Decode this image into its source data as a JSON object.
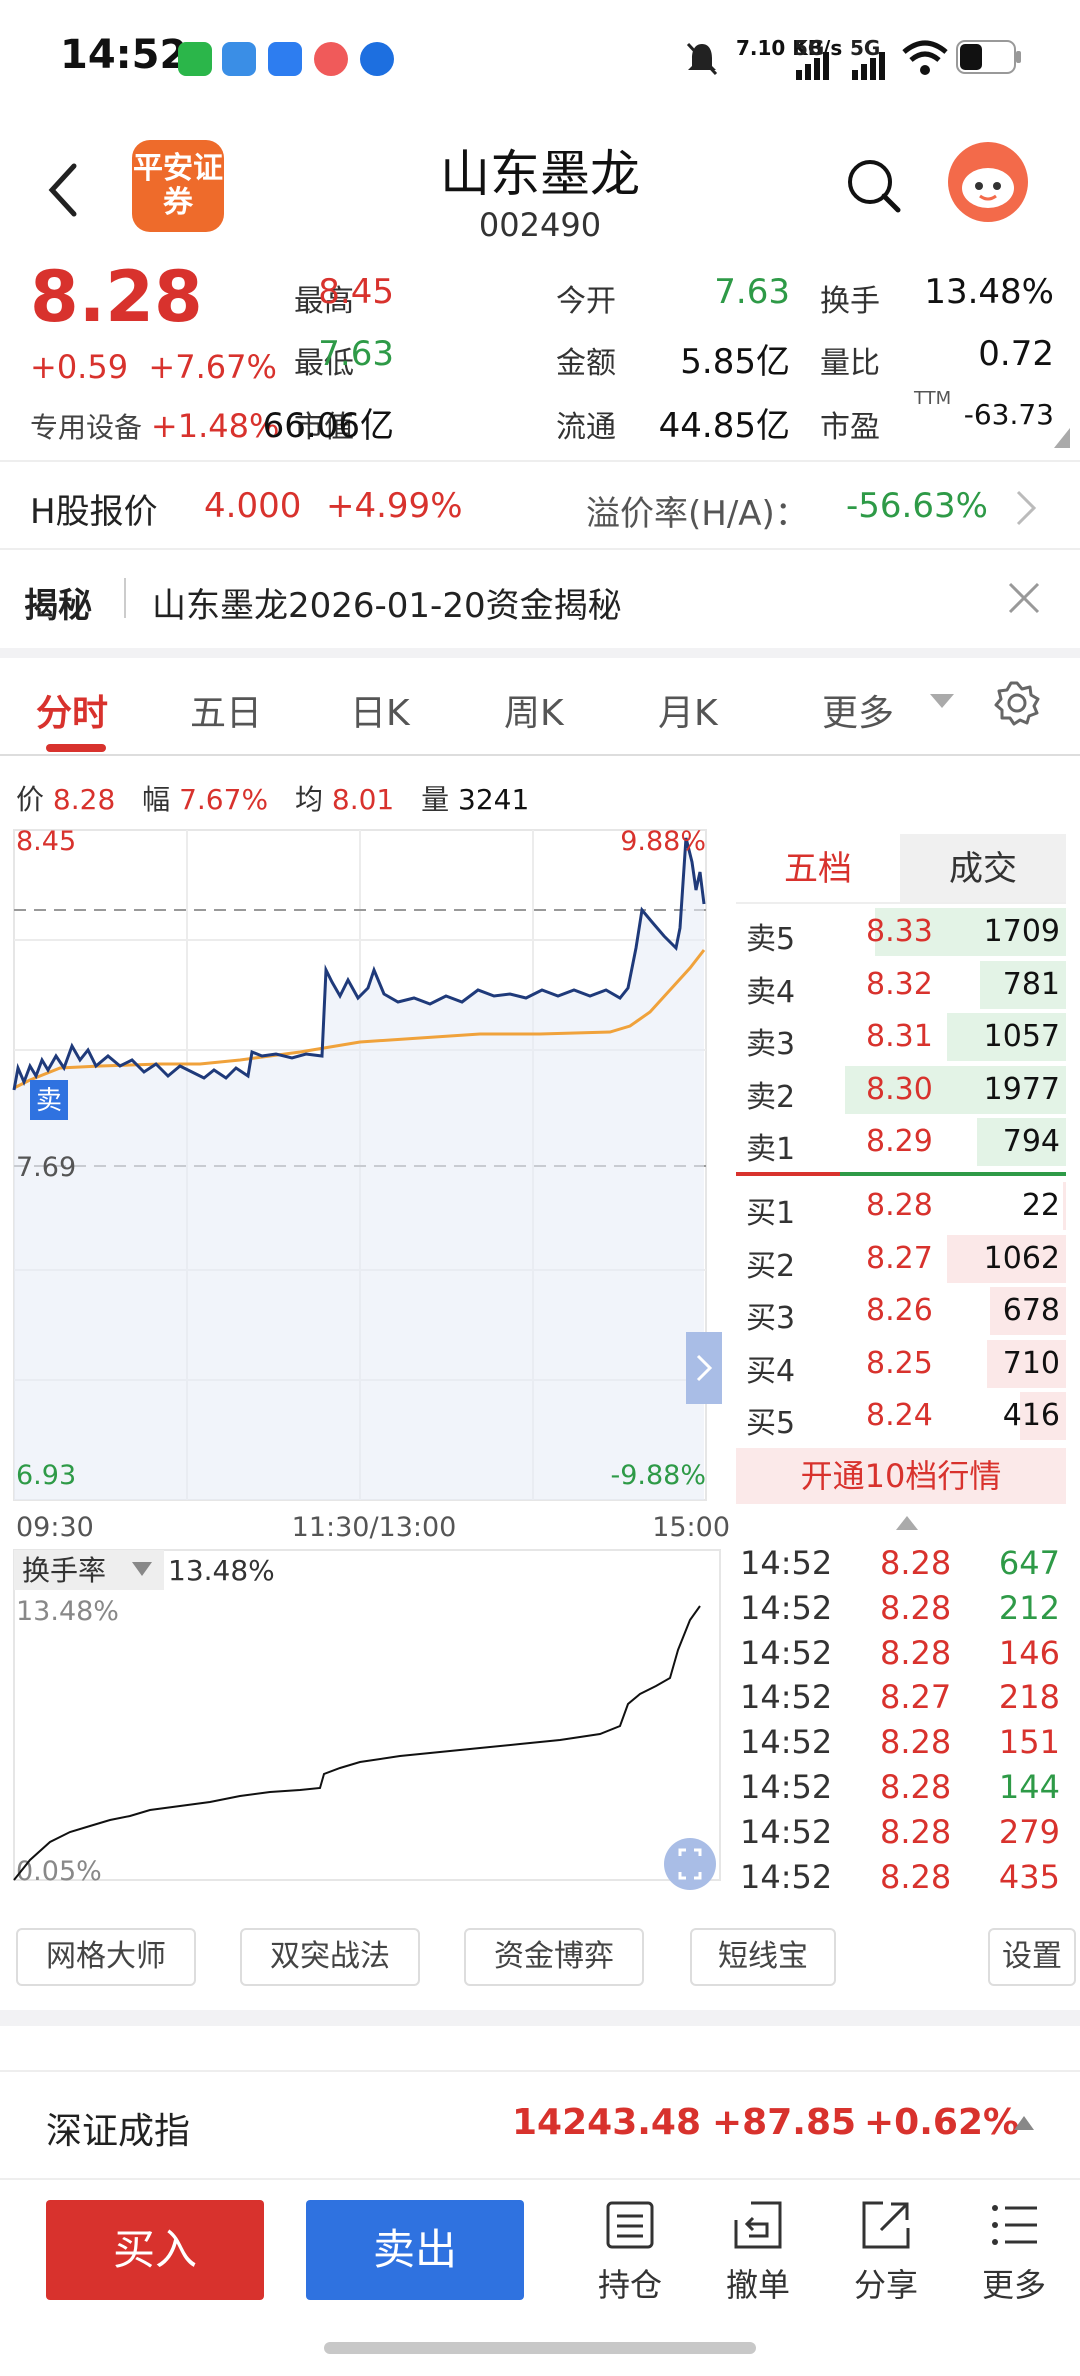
{
  "status_bar": {
    "time": "14:52",
    "net_speed": "7.10 KB/s",
    "sig1": "5G",
    "sig2": "5G"
  },
  "header": {
    "logo_text": "平安证券",
    "stock_name": "山东墨龙",
    "stock_code": "002490"
  },
  "quote": {
    "price": "8.28",
    "change": "+0.59",
    "change_pct": "+7.67%",
    "sector_name": "专用设备",
    "sector_pct": "+1.48%",
    "stats": [
      {
        "label": "最高",
        "value": "8.45",
        "tone": "red"
      },
      {
        "label": "今开",
        "value": "7.63",
        "tone": "green"
      },
      {
        "label": "换手",
        "value": "13.48%",
        "tone": "black"
      },
      {
        "label": "最低",
        "value": "7.63",
        "tone": "green"
      },
      {
        "label": "金额",
        "value": "5.85亿",
        "tone": "black"
      },
      {
        "label": "量比",
        "value": "0.72",
        "tone": "black"
      },
      {
        "label": "市值",
        "value": "66.06亿",
        "tone": "black"
      },
      {
        "label": "流通",
        "value": "44.85亿",
        "tone": "black"
      },
      {
        "label": "市盈",
        "value": "-63.73",
        "tone": "black"
      }
    ],
    "pe_sup": "TTM"
  },
  "h_share": {
    "label": "H股报价",
    "price": "4.000",
    "pct": "+4.99%",
    "premium_label": "溢价率(H/A)：",
    "premium": "-56.63%"
  },
  "reveal": {
    "tag": "揭秘",
    "text": "山东墨龙2026-01-20资金揭秘"
  },
  "tabs": [
    "分时",
    "五日",
    "日K",
    "周K",
    "月K",
    "更多"
  ],
  "info_line": {
    "price_label": "价",
    "price": "8.28",
    "amp_label": "幅",
    "amp": "7.67%",
    "avg_label": "均",
    "avg": "8.01",
    "vol_label": "量",
    "vol": "3241"
  },
  "chart_labels": {
    "top_left": "8.45",
    "top_right": "9.88%",
    "mid_left": "7.69",
    "bottom_left": "6.93",
    "bottom_right": "-9.88%",
    "sell_marker": "卖",
    "time_start": "09:30",
    "time_mid": "11:30/13:00",
    "time_end": "15:00"
  },
  "turnover": {
    "selector": "换手率",
    "value": "13.48%",
    "top_label": "13.48%",
    "bottom_label": "0.05%"
  },
  "order_book": {
    "tabs": [
      "五档",
      "成交"
    ],
    "asks": [
      {
        "label": "卖5",
        "price": "8.33",
        "vol": "1709",
        "bar": 0.58
      },
      {
        "label": "卖4",
        "price": "8.32",
        "vol": "781",
        "bar": 0.26
      },
      {
        "label": "卖3",
        "price": "8.31",
        "vol": "1057",
        "bar": 0.36
      },
      {
        "label": "卖2",
        "price": "8.30",
        "vol": "1977",
        "bar": 0.67
      },
      {
        "label": "卖1",
        "price": "8.29",
        "vol": "794",
        "bar": 0.27
      }
    ],
    "bids": [
      {
        "label": "买1",
        "price": "8.28",
        "vol": "22",
        "bar": 0.01
      },
      {
        "label": "买2",
        "price": "8.27",
        "vol": "1062",
        "bar": 0.36
      },
      {
        "label": "买3",
        "price": "8.26",
        "vol": "678",
        "bar": 0.23
      },
      {
        "label": "买4",
        "price": "8.25",
        "vol": "710",
        "bar": 0.24
      },
      {
        "label": "买5",
        "price": "8.24",
        "vol": "416",
        "bar": 0.14
      }
    ],
    "open10": "开通10档行情"
  },
  "trades": [
    {
      "time": "14:52",
      "price": "8.28",
      "vol": "647",
      "side": "buy"
    },
    {
      "time": "14:52",
      "price": "8.28",
      "vol": "212",
      "side": "buy"
    },
    {
      "time": "14:52",
      "price": "8.28",
      "vol": "146",
      "side": "sell"
    },
    {
      "time": "14:52",
      "price": "8.27",
      "vol": "218",
      "side": "sell"
    },
    {
      "time": "14:52",
      "price": "8.28",
      "vol": "151",
      "side": "sell"
    },
    {
      "time": "14:52",
      "price": "8.28",
      "vol": "144",
      "side": "buy"
    },
    {
      "time": "14:52",
      "price": "8.28",
      "vol": "279",
      "side": "sell"
    },
    {
      "time": "14:52",
      "price": "8.28",
      "vol": "435",
      "side": "sell"
    }
  ],
  "tools": [
    "网格大师",
    "双突战法",
    "资金博弈",
    "短线宝",
    "设置"
  ],
  "index": {
    "name": "深证成指",
    "value": "14243.48",
    "change": "+87.85",
    "pct": "+0.62%"
  },
  "bottom": {
    "buy": "买入",
    "sell": "卖出",
    "items": [
      "持仓",
      "撤单",
      "分享",
      "更多"
    ]
  },
  "colors": {
    "up": "#d8322d",
    "down": "#2e9a47",
    "price_line": "#1f3a7a",
    "avg_line": "#f0a23b"
  }
}
